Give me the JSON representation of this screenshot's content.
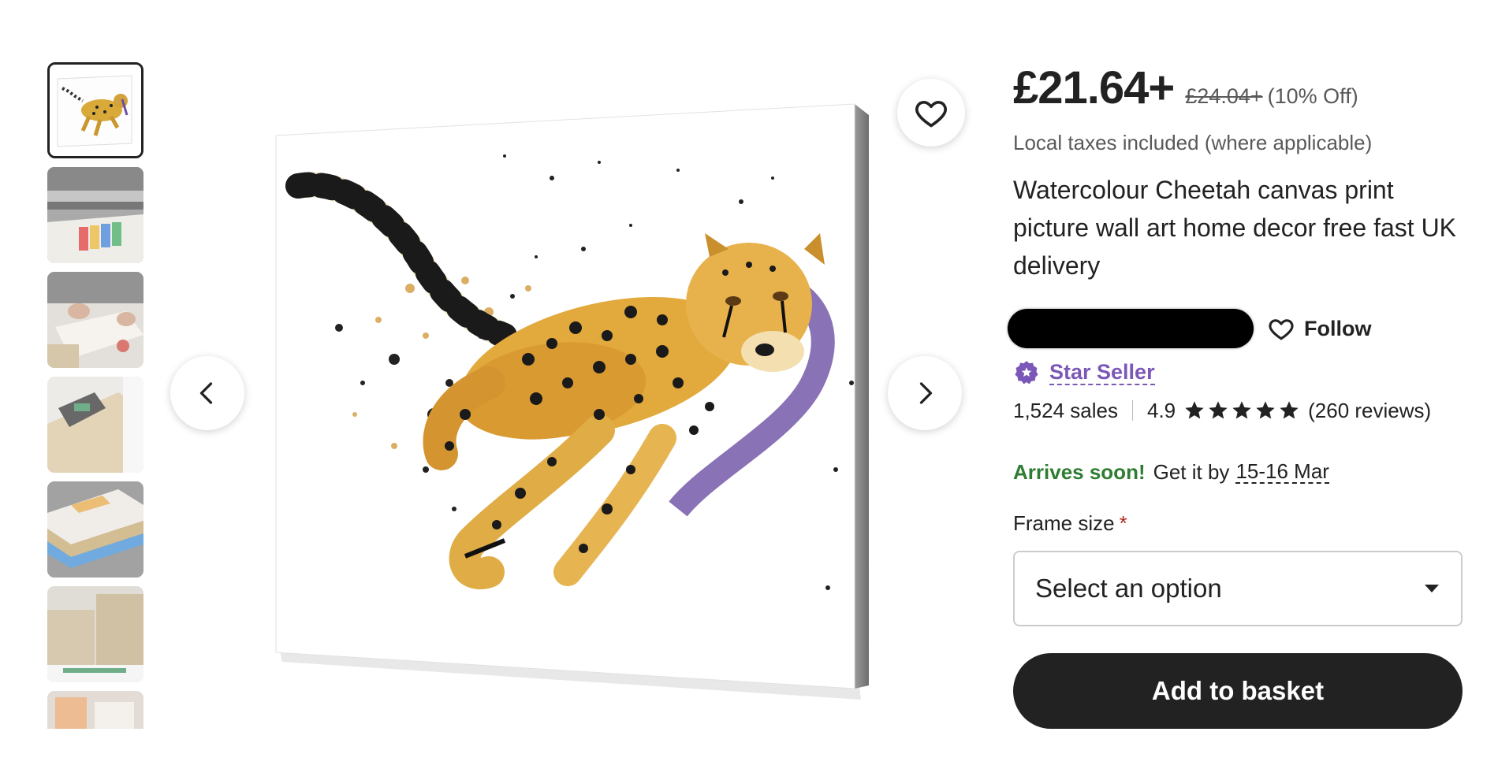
{
  "gallery": {
    "thumbnails": [
      {
        "name": "cheetah-thumbnail"
      },
      {
        "name": "printer-thumbnail"
      },
      {
        "name": "framing-thumbnail"
      },
      {
        "name": "stapler-thumbnail"
      },
      {
        "name": "canvas-stack-thumbnail"
      },
      {
        "name": "wood-frames-thumbnail"
      },
      {
        "name": "partial-thumbnail"
      }
    ],
    "active_index": 0,
    "favorite_icon": "heart-outline-icon",
    "prev_icon": "chevron-left-icon",
    "next_icon": "chevron-right-icon"
  },
  "product": {
    "price": "£21.64+",
    "original_price": "£24.04+",
    "discount": "(10% Off)",
    "tax_note": "Local taxes included (where applicable)",
    "title": "Watercolour Cheetah canvas print picture wall art home decor free fast UK delivery"
  },
  "shop": {
    "follow_label": "Follow",
    "star_seller_label": "Star Seller",
    "sales": "1,524 sales",
    "rating": "4.9",
    "stars": 5,
    "reviews": "(260 reviews)"
  },
  "delivery": {
    "arrives_label": "Arrives soon!",
    "get_it_by": "Get it by",
    "dates": "15-16 Mar"
  },
  "options": {
    "frame_size_label": "Frame size",
    "required_mark": "*",
    "select_placeholder": "Select an option"
  },
  "cta": {
    "add_to_basket": "Add to basket"
  },
  "colors": {
    "text": "#222222",
    "muted": "#595959",
    "star_seller": "#7b58b8",
    "arrives": "#2f7d32",
    "button_bg": "#222222"
  }
}
